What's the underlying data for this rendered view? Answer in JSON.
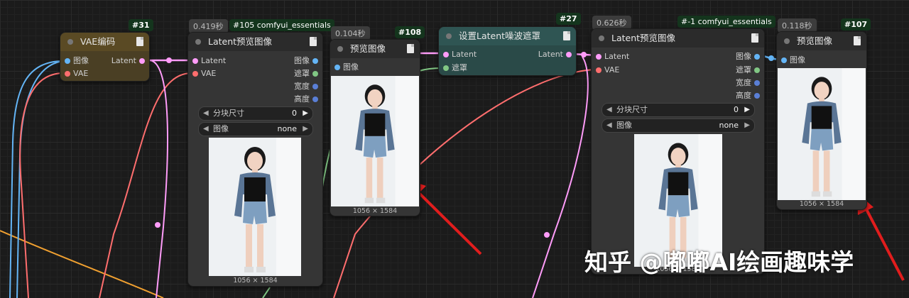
{
  "nodes": {
    "vae_encode": {
      "id_badge": "#31",
      "title": "VAE编码",
      "inputs": [
        "图像",
        "VAE"
      ],
      "output": "Latent"
    },
    "latent_preview_105": {
      "time_badge": "0.419秒",
      "id_badge": "#105 comfyui_essentials",
      "title": "Latent预览图像",
      "inputs": [
        "Latent",
        "VAE"
      ],
      "outputs": [
        "图像",
        "遮罩",
        "宽度",
        "高度"
      ],
      "widgets": [
        {
          "label": "分块尺寸",
          "value": "0"
        },
        {
          "label": "图像",
          "value": "none"
        }
      ],
      "dims": "1056 × 1584"
    },
    "preview_108": {
      "time_badge": "0.104秒",
      "id_badge": "#108",
      "title": "预览图像",
      "inputs": [
        "图像"
      ],
      "dims": "1056 × 1584"
    },
    "set_latent_mask": {
      "id_badge": "#27",
      "title": "设置Latent噪波遮罩",
      "inputs": [
        "Latent",
        "遮罩"
      ],
      "output": "Latent"
    },
    "latent_preview_m1": {
      "time_badge": "0.626秒",
      "id_badge": "#-1 comfyui_essentials",
      "title": "Latent预览图像",
      "inputs": [
        "Latent",
        "VAE"
      ],
      "outputs": [
        "图像",
        "遮罩",
        "宽度",
        "高度"
      ],
      "widgets": [
        {
          "label": "分块尺寸",
          "value": "0"
        },
        {
          "label": "图像",
          "value": "none"
        }
      ],
      "dims": "1056 × 1584"
    },
    "preview_107": {
      "time_badge": "0.118秒",
      "id_badge": "#107",
      "title": "预览图像",
      "inputs": [
        "图像"
      ],
      "dims": "1056 × 1584"
    }
  },
  "colors": {
    "image": "#64b5f6",
    "vae": "#ff6e6e",
    "latent": "#ff9cf9",
    "mask": "#81c784",
    "int": "#5a7fd6",
    "float": "#f0a030",
    "arrow": "#e11d1d"
  },
  "watermark": "知乎 @嘟嘟AI绘画趣味学"
}
